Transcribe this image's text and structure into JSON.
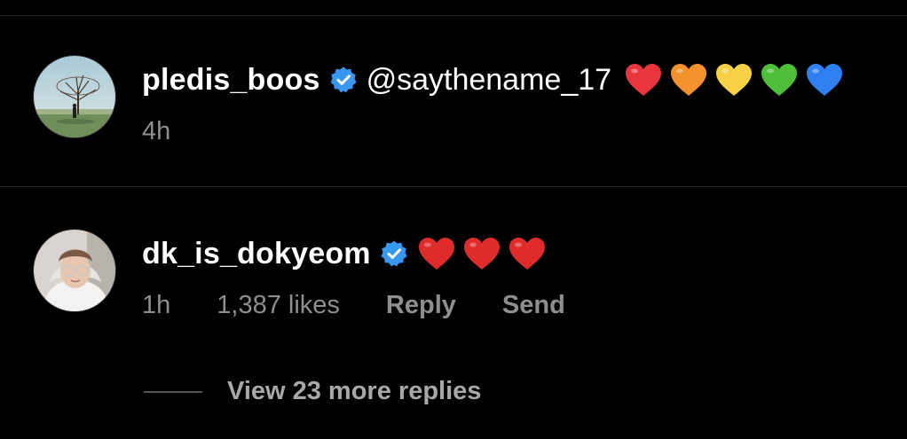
{
  "comments": [
    {
      "username": "pledis_boos",
      "verified": true,
      "mention": "@saythename_17",
      "hearts": [
        "#e8343b",
        "#f3912d",
        "#f8d046",
        "#4fbf3a",
        "#2f7ff0"
      ],
      "time": "4h"
    },
    {
      "username": "dk_is_dokyeom",
      "verified": true,
      "hearts": [
        "#e02b2b",
        "#e02b2b",
        "#e02b2b"
      ],
      "time": "1h",
      "likes": "1,387 likes",
      "reply_label": "Reply",
      "send_label": "Send"
    }
  ],
  "view_replies": "View 23 more replies",
  "colors": {
    "background": "#000000",
    "text": "#ffffff",
    "muted": "#8e8e8e",
    "verified": "#3897f0"
  }
}
